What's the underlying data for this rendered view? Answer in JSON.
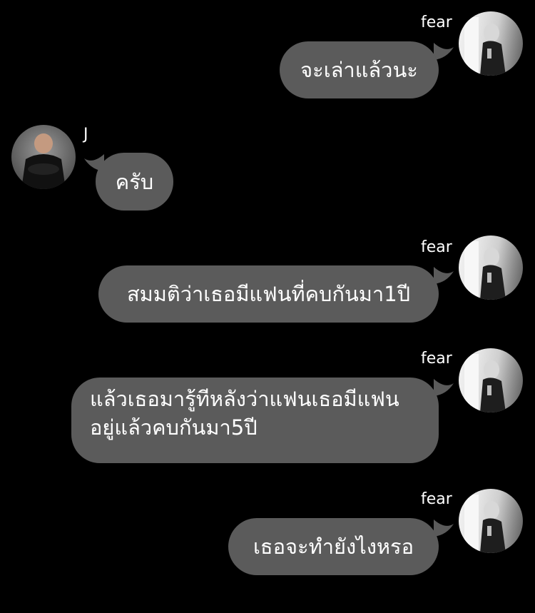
{
  "messages": [
    {
      "sender": "fear",
      "text": "จะเล่าแล้วนะ"
    },
    {
      "sender": "J",
      "text": "ครับ"
    },
    {
      "sender": "fear",
      "text": "สมมติว่าเธอมีแฟนที่คบกันมา1ปี"
    },
    {
      "sender": "fear",
      "text": "แล้วเธอมารู้ทีหลังว่าแฟนเธอมีแฟน\nอยู่แล้วคบกันมา5ปี"
    },
    {
      "sender": "fear",
      "text": "เธอจะทำยังไงหรอ"
    }
  ],
  "colors": {
    "background": "#000000",
    "bubble": "#5b5b5b",
    "text": "#ffffff"
  }
}
